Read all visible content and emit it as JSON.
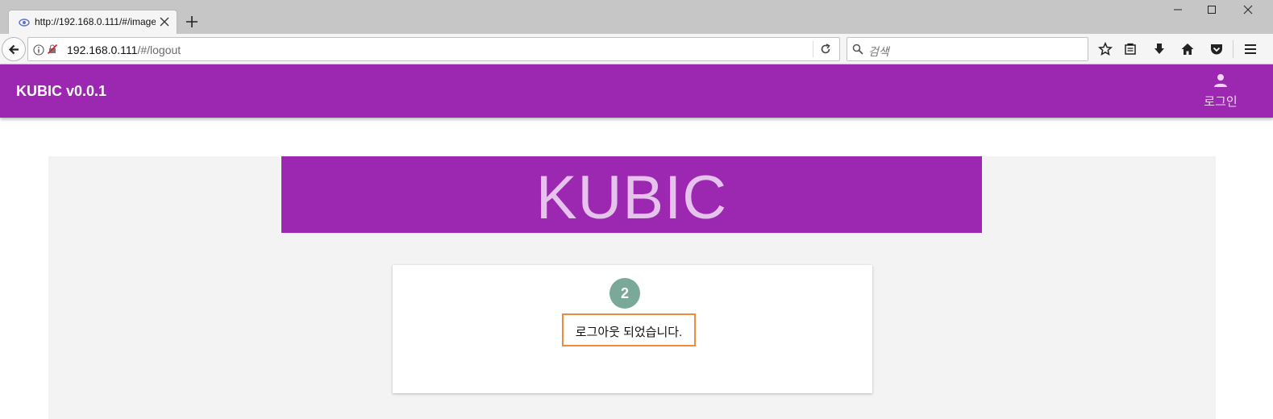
{
  "browser": {
    "tab_title": "http://192.168.0.111/#/image",
    "url_host": "192.168.0.111",
    "url_path": "/#/logout",
    "search_placeholder": "검색",
    "icons": {
      "favicon": "eye-icon",
      "tab_close": "close-icon",
      "new_tab": "plus-icon",
      "back": "back-arrow-icon",
      "info": "info-icon",
      "insecure": "insecure-connection-icon",
      "reload": "reload-icon",
      "search": "search-icon",
      "bookmark": "star-icon",
      "reading_list": "clipboard-icon",
      "downloads": "download-icon",
      "home": "home-icon",
      "pocket": "pocket-icon",
      "menu": "hamburger-menu-icon",
      "minimize": "minimize-icon",
      "maximize": "maximize-icon",
      "close_window": "close-window-icon"
    }
  },
  "app": {
    "title": "KUBIC v0.0.1",
    "login_label": "로그인",
    "login_icon": "person-icon",
    "brand": "KUBIC",
    "step_number": "2",
    "logout_message": "로그아웃 되었습니다.",
    "colors": {
      "primary": "#9c27b0",
      "brand_text": "#e6c3ec",
      "badge": "#7aa899",
      "highlight_border": "#ef8b3a",
      "content_bg": "#f3f3f3"
    }
  }
}
